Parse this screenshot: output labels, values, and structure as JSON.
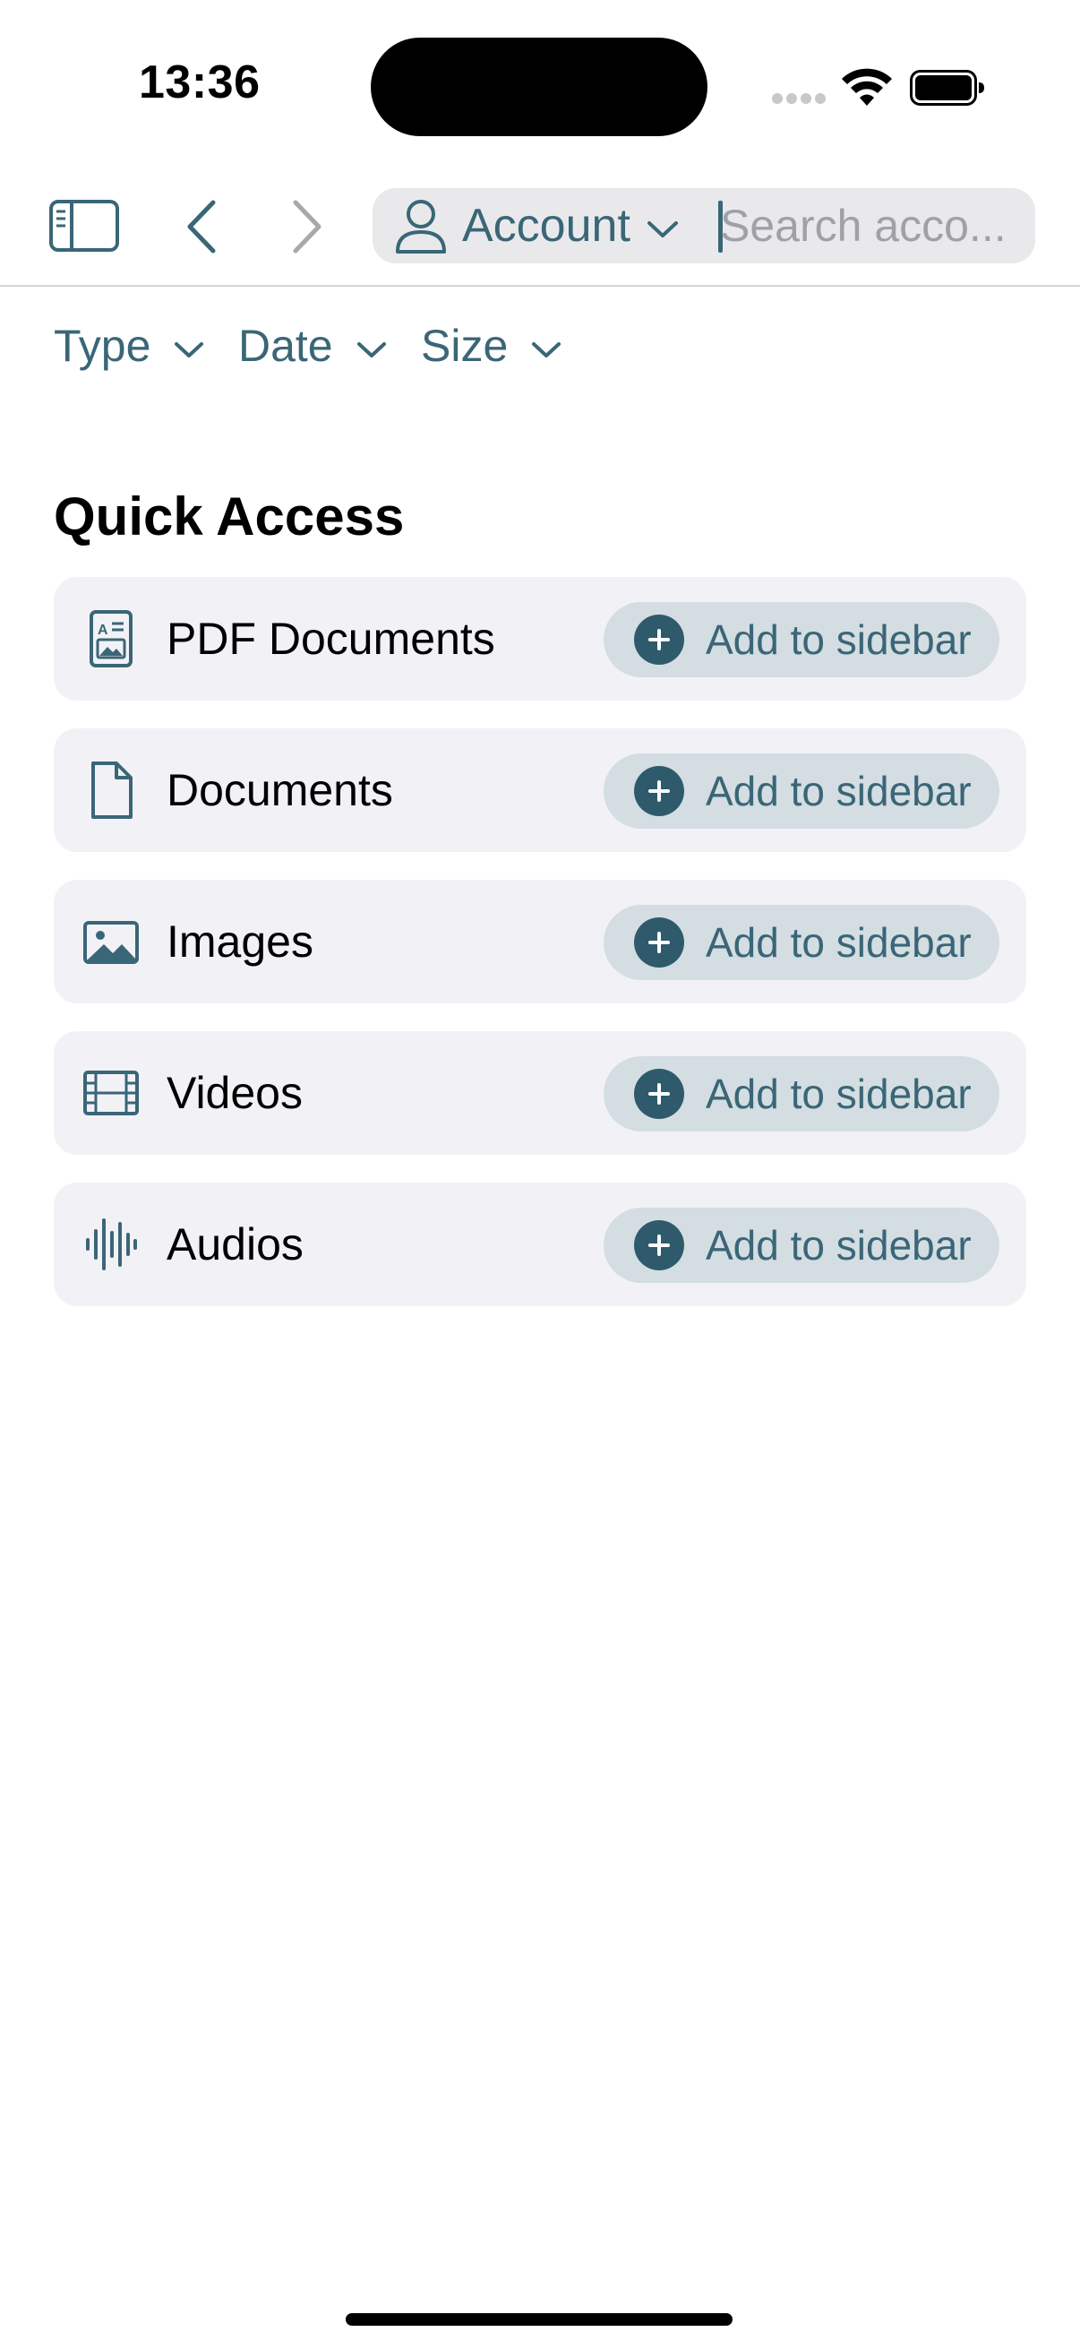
{
  "status_bar": {
    "time": "13:36"
  },
  "toolbar": {
    "account_label": "Account",
    "search_placeholder": "Search acco..."
  },
  "filters": [
    {
      "label": "Type"
    },
    {
      "label": "Date"
    },
    {
      "label": "Size"
    }
  ],
  "quick_access": {
    "title": "Quick Access",
    "items": [
      {
        "label": "PDF Documents",
        "icon": "pdf-document-icon",
        "action_label": "Add to sidebar"
      },
      {
        "label": "Documents",
        "icon": "document-icon",
        "action_label": "Add to sidebar"
      },
      {
        "label": "Images",
        "icon": "image-icon",
        "action_label": "Add to sidebar"
      },
      {
        "label": "Videos",
        "icon": "film-icon",
        "action_label": "Add to sidebar"
      },
      {
        "label": "Audios",
        "icon": "waveform-icon",
        "action_label": "Add to sidebar"
      }
    ]
  },
  "colors": {
    "accent": "#3a6677",
    "accent_dark": "#2e5a6c",
    "row_background": "#f2f2f6",
    "button_background": "#d3dde2"
  }
}
